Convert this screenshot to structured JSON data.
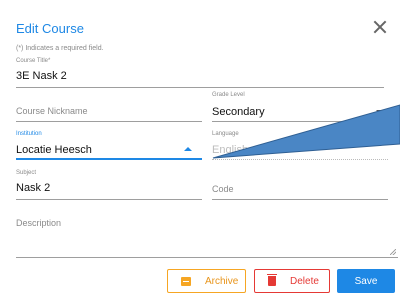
{
  "dialog": {
    "title": "Edit Course",
    "required_note": "(*) Indicates a required field."
  },
  "fields": {
    "course_title": {
      "label": "Course Title*",
      "value": "3E Nask 2"
    },
    "course_nickname": {
      "placeholder": "Course Nickname"
    },
    "grade_level": {
      "label": "Grade Level",
      "value": "Secondary"
    },
    "institution": {
      "label": "Institution",
      "value": "Locatie Heesch"
    },
    "language": {
      "label": "Language",
      "value": "English"
    },
    "subject": {
      "label": "Subject",
      "value": "Nask 2"
    },
    "code": {
      "placeholder": "Code"
    },
    "description": {
      "placeholder": "Description"
    }
  },
  "buttons": {
    "archive": "Archive",
    "delete": "Delete",
    "save": "Save"
  },
  "icons": {
    "close": "close-icon",
    "archive": "archive-icon",
    "delete": "trash-icon",
    "dropdown": "caret-icon"
  },
  "colors": {
    "accent": "#1e88e5",
    "archive": "#f6a623",
    "delete": "#e53935",
    "annotation_fill": "#4a86c5"
  }
}
